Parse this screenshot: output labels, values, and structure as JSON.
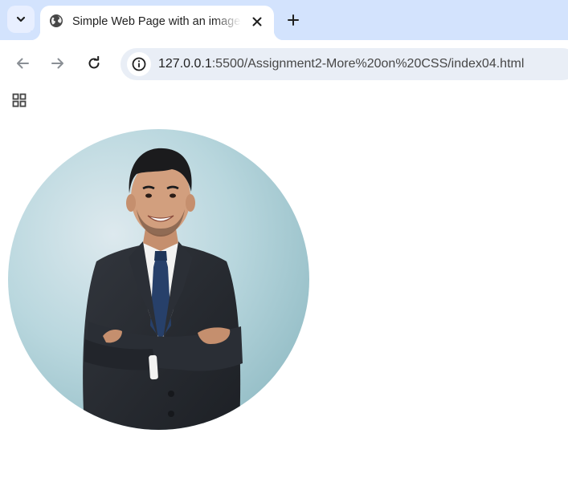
{
  "browser": {
    "tab": {
      "title": "Simple Web Page with an image",
      "favicon": "globe-icon",
      "close_icon": "close-icon"
    },
    "tab_search_icon": "chevron-down-icon",
    "new_tab_icon": "plus-icon",
    "nav": {
      "back_icon": "arrow-left-icon",
      "forward_icon": "arrow-right-icon",
      "reload_icon": "reload-icon"
    },
    "address": {
      "site_info_icon": "info-icon",
      "host": "127.0.0.1",
      "path": ":5500/Assignment2-More%20on%20CSS/index04.html"
    },
    "bookmarks_bar": {
      "apps_icon": "apps-grid-icon"
    }
  },
  "page": {
    "image": {
      "subject": "man-in-suit-with-crossed-arms",
      "shape": "circle"
    }
  },
  "colors": {
    "tabstrip_bg": "#d3e3fd",
    "omnibox_bg": "#e9eef6",
    "photo_bg": "#b7d6dd",
    "suit": "#262a30",
    "tie": "#27406a"
  }
}
